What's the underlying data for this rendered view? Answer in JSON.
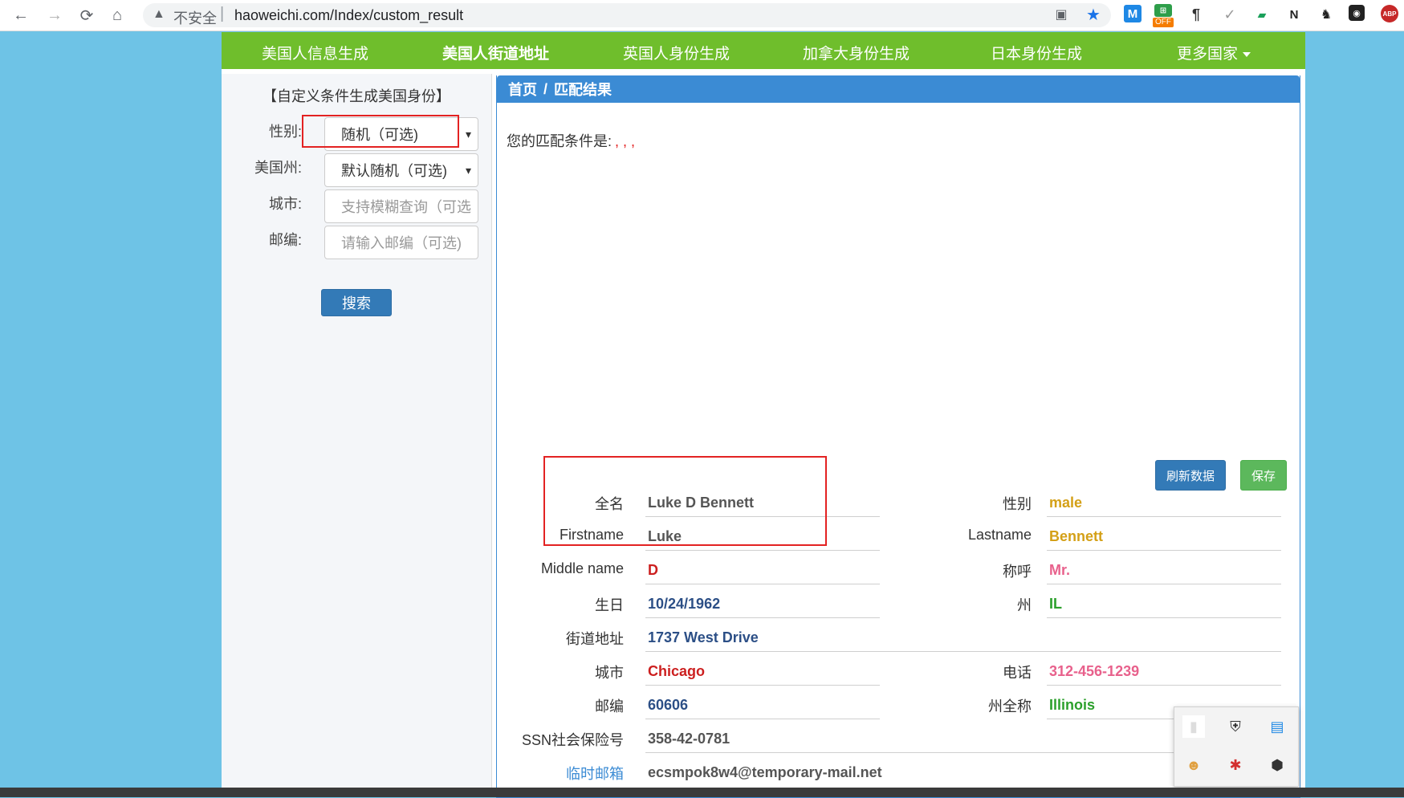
{
  "browser": {
    "back_icon": "←",
    "forward_icon": "→",
    "reload_icon": "⟳",
    "home_icon": "⌂",
    "security_label": "不安全",
    "url": "haoweichi.com/Index/custom_result",
    "off_badge": "OFF"
  },
  "topnav": {
    "items": [
      "美国人信息生成",
      "美国人街道地址",
      "英国人身份生成",
      "加拿大身份生成",
      "日本身份生成",
      "更多国家"
    ]
  },
  "sidebar": {
    "title": "【自定义条件生成美国身份】",
    "gender_label": "性别:",
    "gender_value": "随机（可选)",
    "state_label": "美国州:",
    "state_value": "默认随机（可选)",
    "city_label": "城市:",
    "city_placeholder": "支持模糊查询（可选)",
    "zip_label": "邮编:",
    "zip_placeholder": "请输入邮编（可选)",
    "search_label": "搜索"
  },
  "panel": {
    "crumb_home": "首页",
    "crumb_sep": "/",
    "crumb_current": "匹配结果",
    "condition_label": "您的匹配条件是:",
    "condition_value": ", , ,",
    "refresh_label": "刷新数据",
    "save_label": "保存"
  },
  "fields": {
    "fullname_label": "全名",
    "fullname": "Luke D Bennett",
    "gender_label": "性别",
    "gender": "male",
    "firstname_label": "Firstname",
    "firstname": "Luke",
    "lastname_label": "Lastname",
    "lastname": "Bennett",
    "middlename_label": "Middle name",
    "middlename": "D",
    "title_label": "称呼",
    "title": "Mr.",
    "birthday_label": "生日",
    "birthday": "10/24/1962",
    "state_label": "州",
    "state": "IL",
    "street_label": "街道地址",
    "street": "1737 West Drive",
    "city_label": "城市",
    "city": "Chicago",
    "phone_label": "电话",
    "phone": "312-456-1239",
    "zip_label": "邮编",
    "zip": "60606",
    "state_full_label": "州全称",
    "state_full": "Illinois",
    "ssn_label": "SSN社会保险号",
    "ssn": "358-42-0781",
    "email_label": "临时邮箱",
    "email": "ecsmpok8w4@temporary-mail.net"
  },
  "colors": {
    "nav_green": "#6fbe2c",
    "panel_blue": "#3b8bd4",
    "value_gray": "#555555",
    "value_gold": "#d4a017",
    "value_red": "#cc1f1f",
    "value_pink": "#e8618c",
    "value_navy": "#2c4f86",
    "value_green": "#2ca02c",
    "highlight_red": "#e32222"
  }
}
